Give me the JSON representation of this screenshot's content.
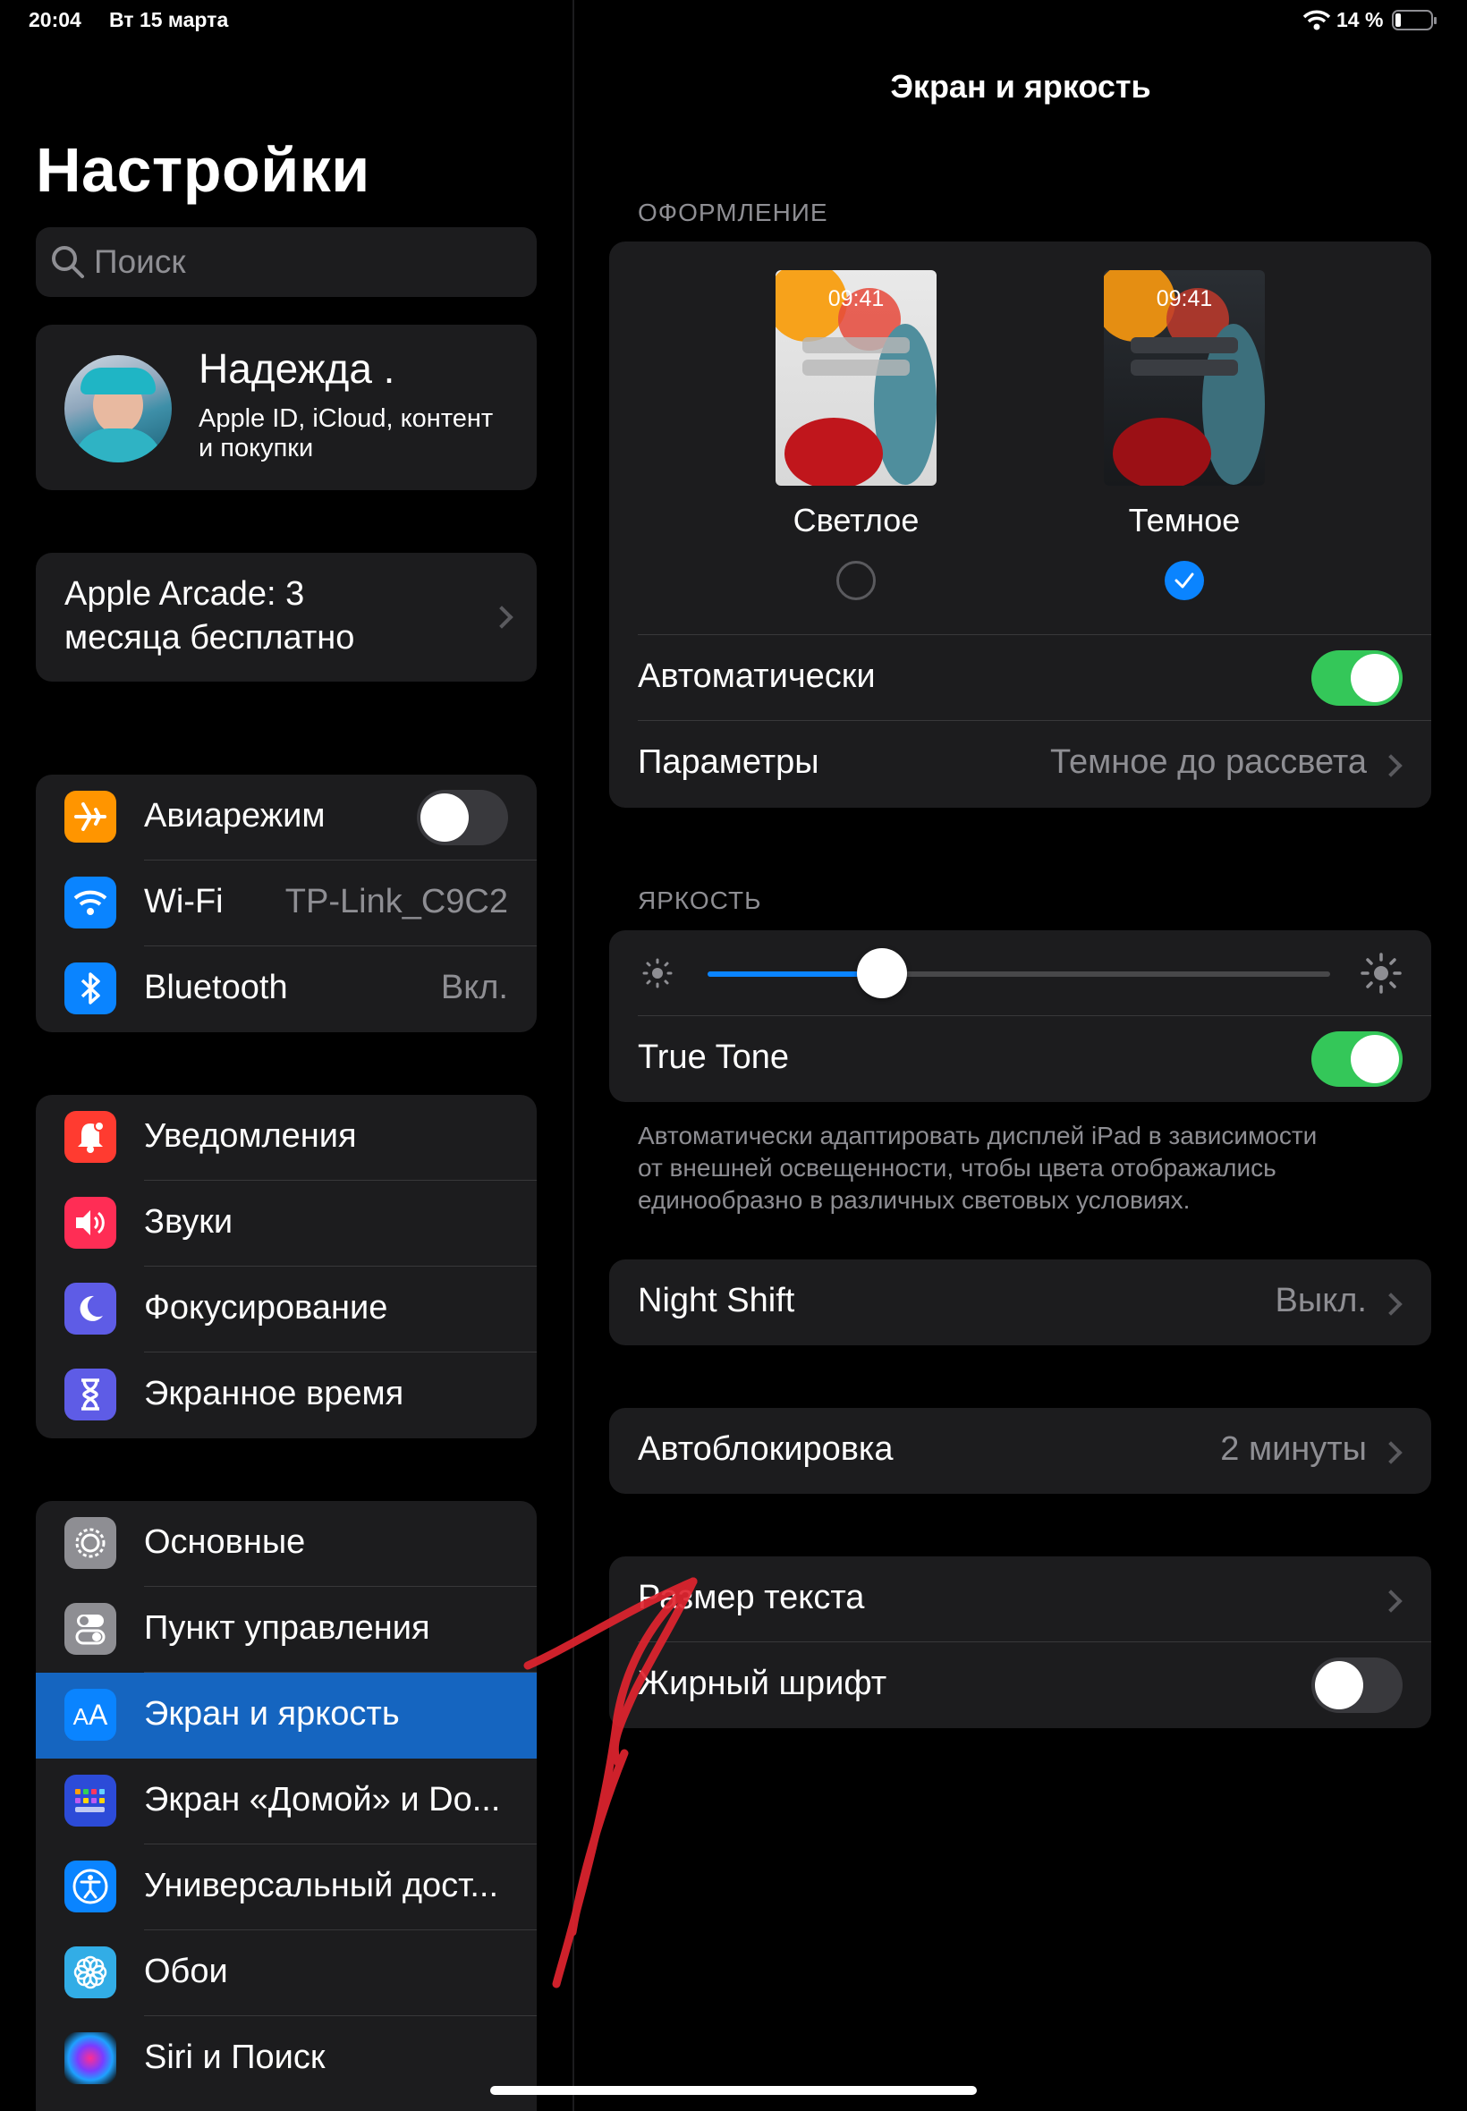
{
  "status_bar": {
    "time": "20:04",
    "date": "Вт 15 марта",
    "battery": "14 %"
  },
  "sidebar": {
    "title": "Настройки",
    "search_placeholder": "Поиск",
    "profile": {
      "name": "Надежда .",
      "subtitle_line1": "Apple ID, iCloud, контент",
      "subtitle_line2": "и покупки"
    },
    "promo": {
      "line1": "Apple Arcade: 3",
      "line2": "месяца бесплатно"
    },
    "group1": [
      {
        "label": "Авиарежим",
        "icon": "airplane-icon",
        "toggle": false
      },
      {
        "label": "Wi-Fi",
        "icon": "wifi-icon",
        "value": "TP-Link_C9C2"
      },
      {
        "label": "Bluetooth",
        "icon": "bluetooth-icon",
        "value": "Вкл."
      }
    ],
    "group2": [
      {
        "label": "Уведомления",
        "icon": "bell-icon"
      },
      {
        "label": "Звуки",
        "icon": "speaker-icon"
      },
      {
        "label": "Фокусирование",
        "icon": "moon-icon"
      },
      {
        "label": "Экранное время",
        "icon": "hourglass-icon"
      }
    ],
    "group3": [
      {
        "label": "Основные",
        "icon": "gear-icon"
      },
      {
        "label": "Пункт управления",
        "icon": "switches-icon"
      },
      {
        "label": "Экран и яркость",
        "icon": "text-size-icon",
        "selected": true
      },
      {
        "label": "Экран «Домой» и Do...",
        "icon": "home-grid-icon"
      },
      {
        "label": "Универсальный дост...",
        "icon": "accessibility-icon"
      },
      {
        "label": "Обои",
        "icon": "flower-icon"
      },
      {
        "label": "Siri и Поиск",
        "icon": "siri-icon"
      }
    ]
  },
  "main": {
    "title": "Экран и яркость",
    "appearance_header": "ОФОРМЛЕНИЕ",
    "thumb_time": "09:41",
    "light_label": "Светлое",
    "dark_label": "Темное",
    "selected_theme": "dark",
    "auto_label": "Автоматически",
    "auto_on": true,
    "params_label": "Параметры",
    "params_value": "Темное до рассвета",
    "brightness_header": "ЯРКОСТЬ",
    "brightness_level": 0.28,
    "true_tone_label": "True Tone",
    "true_tone_on": true,
    "true_tone_note_line1": "Автоматически адаптировать дисплей iPad в зависимости",
    "true_tone_note_line2": "от внешней освещенности, чтобы цвета отображались",
    "true_tone_note_line3": "единообразно в различных световых условиях.",
    "night_shift_label": "Night Shift",
    "night_shift_value": "Выкл.",
    "autolock_label": "Автоблокировка",
    "autolock_value": "2 минуты",
    "text_size_label": "Размер текста",
    "bold_label": "Жирный шрифт",
    "bold_on": false
  },
  "colors": {
    "accent": "#0a84ff",
    "toggle_on": "#34c759",
    "selected_row": "#1565c0",
    "annotation": "#e0242f"
  }
}
